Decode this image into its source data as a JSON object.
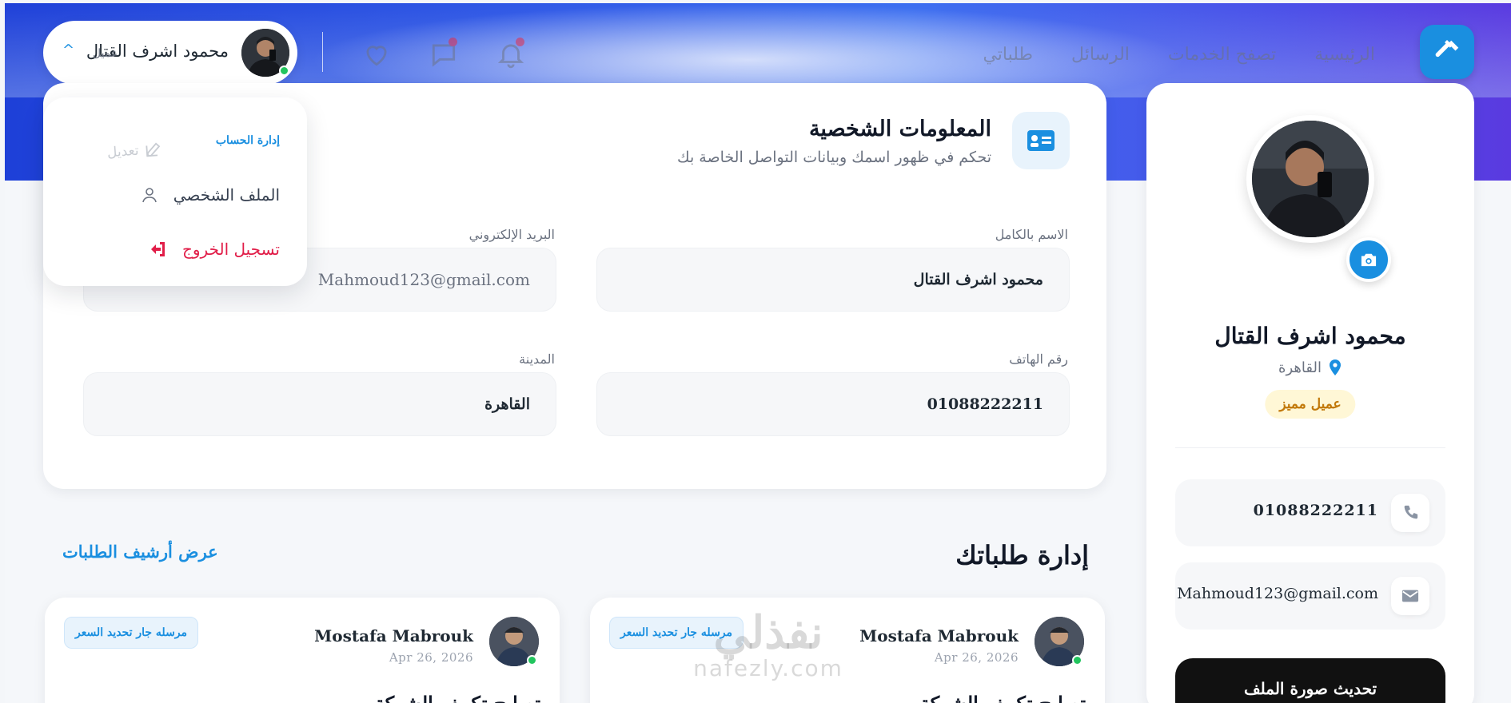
{
  "header": {
    "nav": [
      "الرئيسية",
      "تصفح الخدمات",
      "الرسائل",
      "طلباتي"
    ],
    "user_name": "محمود اشرف القتال",
    "user_role": "عميل"
  },
  "dropdown": {
    "heading": "إدارة الحساب",
    "edit_label": "تعديل",
    "profile_label": "الملف الشخصي",
    "logout_label": "تسجيل الخروج"
  },
  "personal_info": {
    "title": "المعلومات الشخصية",
    "subtitle": "تحكم في ظهور اسمك وبيانات التواصل الخاصة بك",
    "full_name_label": "الاسم بالكامل",
    "full_name_value": "محمود اشرف القتال",
    "email_label": "البريد الإلكتروني",
    "email_value": "Mahmoud123@gmail.com",
    "phone_label": "رقم الهاتف",
    "phone_value": "01088222211",
    "city_label": "المدينة",
    "city_value": "القاهرة"
  },
  "profile_card": {
    "name": "محمود اشرف القتال",
    "city": "القاهرة",
    "badge": "عميل مميز",
    "phone": "01088222211",
    "email": "Mahmoud123@gmail.com",
    "update_button": "تحديث صورة الملف"
  },
  "orders": {
    "title": "إدارة طلباتك",
    "archive_link": "عرض أرشيف الطلبات",
    "cards": [
      {
        "name": "Mostafa Mabrouk",
        "date": "Apr 26, 2026",
        "status": "مرسله جار تحديد السعر",
        "title": "تصليح تكييف الشركة"
      },
      {
        "name": "Mostafa Mabrouk",
        "date": "Apr 26, 2026",
        "status": "مرسله جار تحديد السعر",
        "title": "تصليح تكييف الشركة"
      }
    ]
  },
  "watermark": {
    "ar": "نفذلي",
    "en": "nafezly.com"
  },
  "colors": {
    "accent": "#1a8fe0",
    "hero_start": "#1e40d8",
    "hero_end": "#5a3ae0",
    "danger": "#e11d48",
    "badge_text": "#c2790a"
  }
}
